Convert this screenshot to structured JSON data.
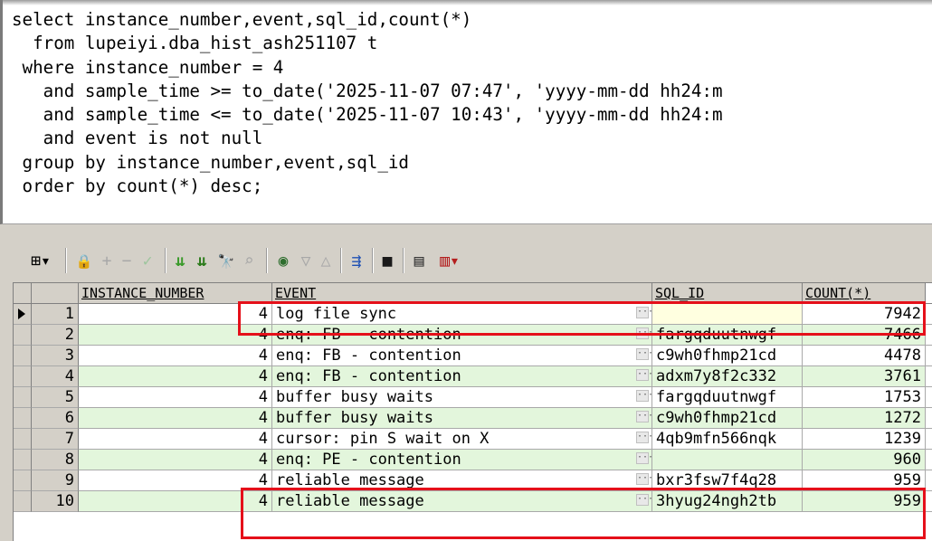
{
  "sql": {
    "lines": [
      "select instance_number,event,sql_id,count(*)",
      "  from lupeiyi.dba_hist_ash251107 t",
      " where instance_number = 4",
      "   and sample_time >= to_date('2025-11-07 07:47', 'yyyy-mm-dd hh24:m",
      "   and sample_time <= to_date('2025-11-07 10:43', 'yyyy-mm-dd hh24:m",
      "   and event is not null",
      " group by instance_number,event,sql_id",
      " order by count(*) desc;"
    ]
  },
  "toolbar": {
    "icons": [
      "grid-options-icon",
      "lock-icon",
      "add-record-icon",
      "delete-record-icon",
      "post-edit-icon",
      "filter-icon",
      "clear-filter-icon",
      "find-icon",
      "clear-icon",
      "query-by-example-icon",
      "sort-down-icon",
      "sort-up-icon",
      "export-icon",
      "save-icon",
      "print-icon",
      "chart-icon"
    ],
    "glyphs": {
      "grid": "⊞▾",
      "lock": "🔒",
      "add": "+",
      "delete": "−",
      "post": "✓",
      "filter": "⇊",
      "clear_filter": "⇊",
      "find": "🔭",
      "clear": "⌕",
      "qbe": "◉",
      "sort_down": "▽",
      "sort_up": "△",
      "export": "⇶",
      "save": "■",
      "print": "▤",
      "chart": "▥▾"
    }
  },
  "grid": {
    "columns": [
      "INSTANCE_NUMBER",
      "EVENT",
      "SQL_ID",
      "COUNT(*)"
    ],
    "rows": [
      {
        "no": "1",
        "instance": "4",
        "event": "log file sync",
        "sql_id": "",
        "count": "7942"
      },
      {
        "no": "2",
        "instance": "4",
        "event": "enq: FB - contention",
        "sql_id": "fargqduutnwgf",
        "count": "7466"
      },
      {
        "no": "3",
        "instance": "4",
        "event": "enq: FB - contention",
        "sql_id": "c9wh0fhmp21cd",
        "count": "4478"
      },
      {
        "no": "4",
        "instance": "4",
        "event": "enq: FB - contention",
        "sql_id": "adxm7y8f2c332",
        "count": "3761"
      },
      {
        "no": "5",
        "instance": "4",
        "event": "buffer busy waits",
        "sql_id": "fargqduutnwgf",
        "count": "1753"
      },
      {
        "no": "6",
        "instance": "4",
        "event": "buffer busy waits",
        "sql_id": "c9wh0fhmp21cd",
        "count": "1272"
      },
      {
        "no": "7",
        "instance": "4",
        "event": "cursor: pin S wait on X",
        "sql_id": "4qb9mfn566nqk",
        "count": "1239"
      },
      {
        "no": "8",
        "instance": "4",
        "event": "enq: PE - contention",
        "sql_id": "",
        "count": "960"
      },
      {
        "no": "9",
        "instance": "4",
        "event": "reliable message",
        "sql_id": "bxr3fsw7f4q28",
        "count": "959"
      },
      {
        "no": "10",
        "instance": "4",
        "event": "reliable message",
        "sql_id": "3hyug24ngh2tb",
        "count": "959"
      }
    ]
  },
  "colors": {
    "highlight": "#e5101a",
    "alt_row": "#e3f6dc",
    "keyword": "#1f1fd0"
  }
}
